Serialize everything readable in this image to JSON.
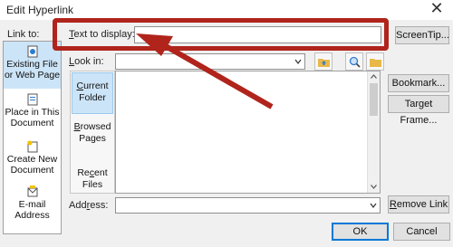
{
  "dialog": {
    "title": "Edit Hyperlink",
    "close_glyph": "✕"
  },
  "link_to": {
    "label": "Link to:",
    "items": [
      {
        "label": "Existing File or Web Page",
        "icon": "web-page-icon",
        "selected": true
      },
      {
        "label": "Place in This Document",
        "icon": "document-place-icon",
        "selected": false
      },
      {
        "label": "Create New Document",
        "icon": "new-document-icon",
        "selected": false
      },
      {
        "label": "E-mail Address",
        "icon": "email-icon",
        "selected": false
      }
    ]
  },
  "text_to_display": {
    "label": "Text to display:",
    "value": ""
  },
  "look_in": {
    "label": "Look in:",
    "value": ""
  },
  "browse": {
    "items": [
      {
        "label": "Current Folder",
        "selected": true
      },
      {
        "label": "Browsed Pages",
        "selected": false
      },
      {
        "label": "Recent Files",
        "selected": false
      }
    ]
  },
  "address": {
    "label": "Address:",
    "value": ""
  },
  "buttons": {
    "screentip": "ScreenTip...",
    "bookmark": "Bookmark...",
    "target_frame": "Target Frame...",
    "remove_link": "Remove Link",
    "ok": "OK",
    "cancel": "Cancel"
  },
  "colors": {
    "highlight": "#b0241c",
    "selection": "#cce4f7",
    "accent": "#0078d7"
  }
}
